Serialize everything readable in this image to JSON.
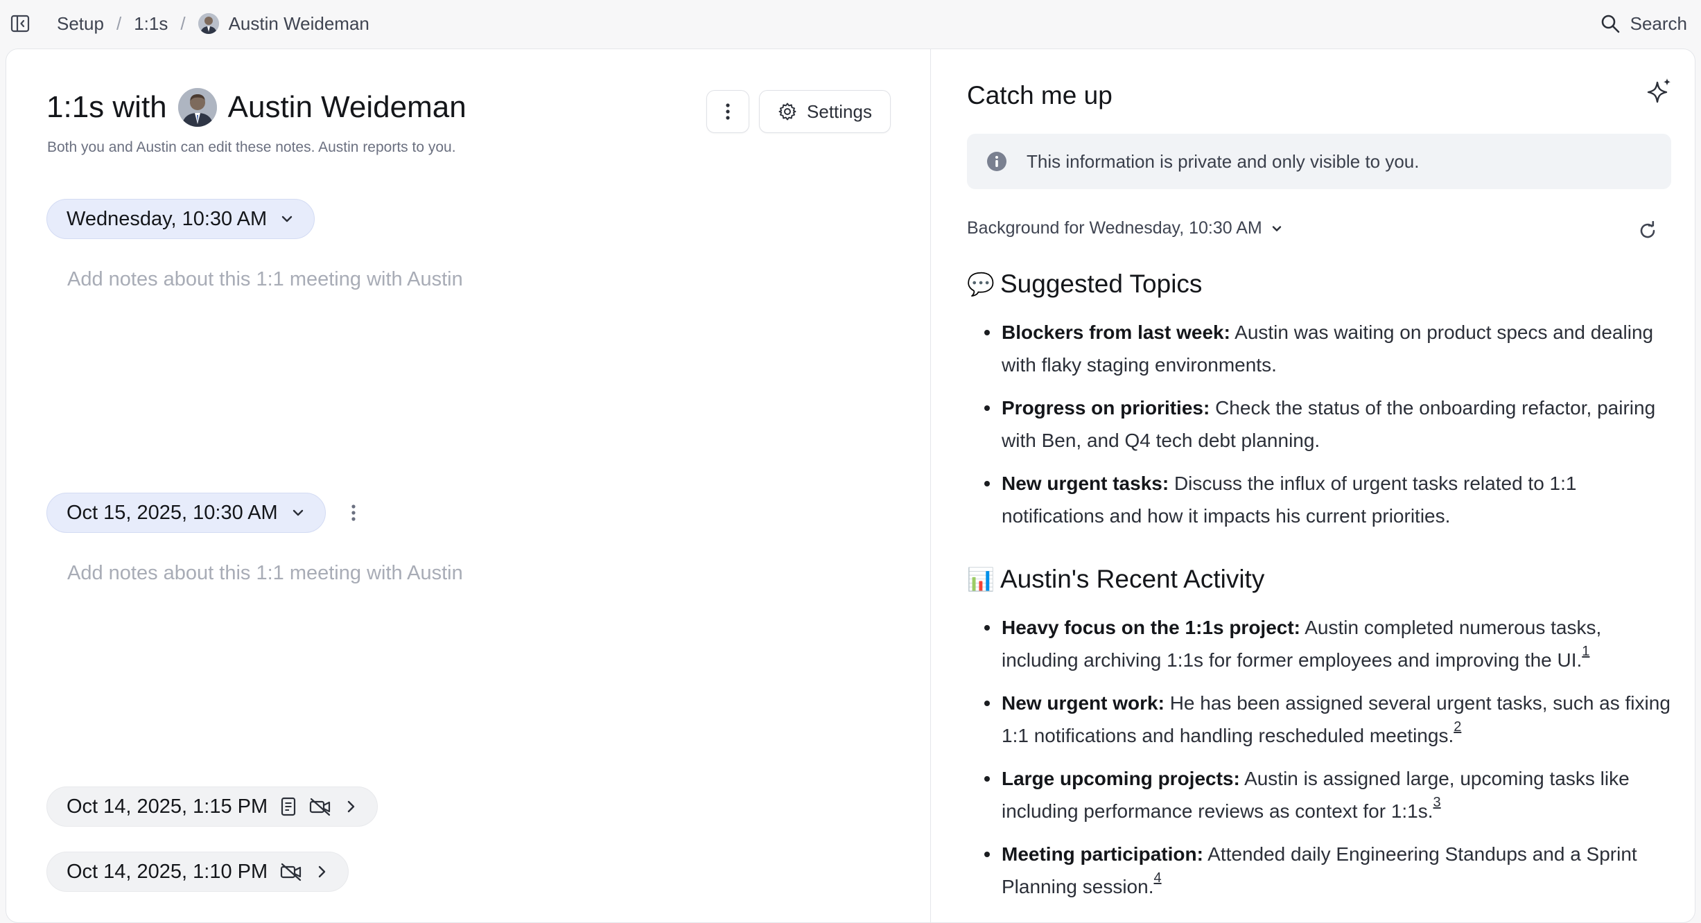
{
  "breadcrumb": {
    "items": [
      "Setup",
      "1:1s"
    ],
    "separator": "/",
    "person": "Austin Weideman"
  },
  "search": {
    "label": "Search"
  },
  "header": {
    "title_prefix": "1:1s with",
    "person_name": "Austin Weideman",
    "subtitle": "Both you and Austin can edit these notes. Austin reports to you.",
    "settings_label": "Settings"
  },
  "meetings": [
    {
      "label": "Wednesday, 10:30 AM",
      "placeholder": "Add notes about this 1:1 meeting with Austin"
    },
    {
      "label": "Oct 15, 2025, 10:30 AM",
      "placeholder": "Add notes about this 1:1 meeting with Austin"
    },
    {
      "label": "Oct 14, 2025, 1:15 PM"
    },
    {
      "label": "Oct 14, 2025, 1:10 PM"
    }
  ],
  "catch_up": {
    "title": "Catch me up",
    "private_notice": "This information is private and only visible to you.",
    "background_select": "Background for Wednesday, 10:30 AM",
    "suggested_topics": {
      "emoji": "💬",
      "heading": "Suggested Topics",
      "items": [
        {
          "bold": "Blockers from last week:",
          "text": " Austin was waiting on product specs and dealing with flaky staging environments."
        },
        {
          "bold": "Progress on priorities:",
          "text": " Check the status of the onboarding refactor, pairing with Ben, and Q4 tech debt planning."
        },
        {
          "bold": "New urgent tasks:",
          "text": " Discuss the influx of urgent tasks related to 1:1 notifications and how it impacts his current priorities."
        }
      ]
    },
    "recent_activity": {
      "emoji": "📊",
      "heading": "Austin's Recent Activity",
      "items": [
        {
          "bold": "Heavy focus on the 1:1s project:",
          "text": " Austin completed numerous tasks, including archiving 1:1s for former employees and improving the UI.",
          "ref": "1"
        },
        {
          "bold": "New urgent work:",
          "text": " He has been assigned several urgent tasks, such as fixing 1:1 notifications and handling rescheduled meetings.",
          "ref": "2"
        },
        {
          "bold": "Large upcoming projects:",
          "text": " Austin is assigned large, upcoming tasks like including performance reviews as context for 1:1s.",
          "ref": "3"
        },
        {
          "bold": "Meeting participation:",
          "text": " Attended daily Engineering Standups and a Sprint Planning session.",
          "ref": "4"
        }
      ]
    }
  },
  "icons": {
    "sidebar_toggle": "sidebar-collapse-icon",
    "search": "search-icon",
    "more": "more-vertical-icon",
    "settings": "gear-icon",
    "chevron": "chevron-down-icon",
    "chevron_right": "chevron-right-icon",
    "notes": "document-icon",
    "no_video": "video-off-icon",
    "info": "info-icon",
    "sparkle": "sparkle-icon",
    "refresh": "refresh-icon"
  },
  "colors": {
    "active_pill": "#e7ecfb",
    "muted_pill": "#f1f2f4",
    "placeholder_text": "#a8acb6",
    "info_box": "#f1f3f6"
  }
}
